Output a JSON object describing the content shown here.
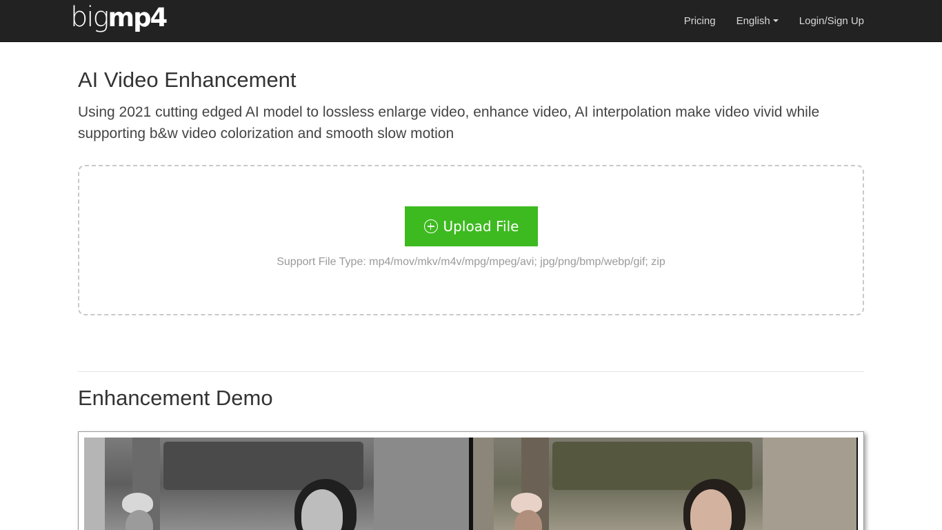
{
  "brand": {
    "logo_light": "big",
    "logo_bold": "mp4"
  },
  "nav": {
    "pricing": "Pricing",
    "language": "English",
    "login": "Login/Sign Up"
  },
  "hero": {
    "title": "AI Video Enhancement",
    "subtitle": "Using 2021 cutting edged AI model to lossless enlarge video, enhance video, AI interpolation make video vivid while supporting b&w video colorization and smooth slow motion"
  },
  "upload": {
    "button_label": "Upload File",
    "support_text": "Support File Type: mp4/mov/mkv/m4v/mpg/mpeg/avi; jpg/png/bmp/webp/gif; zip",
    "icon": "plus-circle-icon",
    "button_color": "#3dba20"
  },
  "demo": {
    "title": "Enhancement Demo"
  }
}
